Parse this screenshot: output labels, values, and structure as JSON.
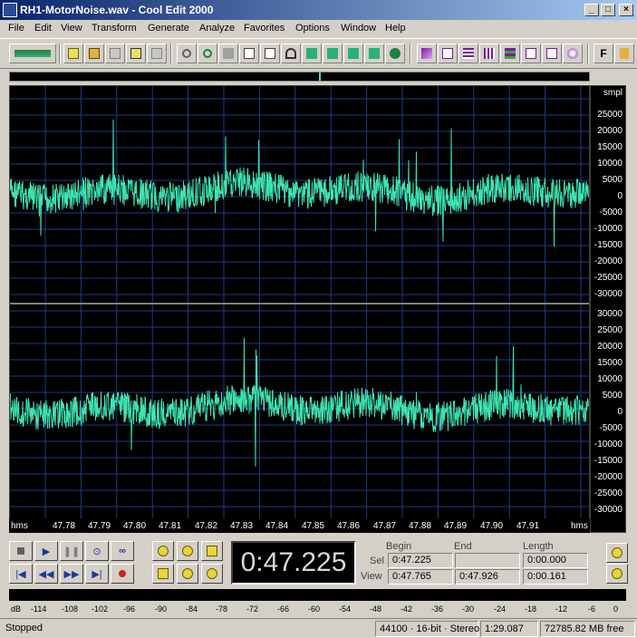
{
  "window": {
    "title": "RH1-MotorNoise.wav - Cool Edit 2000",
    "buttons": [
      "_",
      "□",
      "×"
    ]
  },
  "menu": [
    "File",
    "Edit",
    "View",
    "Transform",
    "Generate",
    "Analyze",
    "Favorites",
    "Options",
    "Window",
    "Help"
  ],
  "toolbar": {
    "icons": [
      "toggle-waveform-multitrack-icon",
      "new-file-icon",
      "open-file-icon",
      "close-file-icon",
      "save-file-icon",
      "save-all-icon",
      "undo-icon",
      "repeat-last-icon",
      "trim-icon",
      "copy-icon",
      "copy-new-icon",
      "cut-icon",
      "paste-icon",
      "paste-new-icon",
      "mix-paste-icon",
      "mix-paste-new-icon",
      "spectral-view-icon",
      "waveform-view-icon",
      "scroll-sync-icon",
      "snap-icon",
      "grid-icon",
      "loop-icon",
      "cue-list-icon",
      "cd-player-icon",
      "f-key-icon",
      "settings-icon"
    ]
  },
  "waveform": {
    "ruler_unit": "smpl",
    "ruler_labels_top": [
      "25000",
      "20000",
      "15000",
      "10000",
      "5000",
      "0",
      "-5000",
      "-10000",
      "-15000",
      "-20000",
      "-25000",
      "-30000"
    ],
    "ruler_labels_bottom": [
      "30000",
      "25000",
      "20000",
      "15000",
      "10000",
      "5000",
      "0",
      "-5000",
      "-10000",
      "-15000",
      "-20000",
      "-25000",
      "-30000"
    ],
    "waveform_color": "#3fe3b0",
    "grid_color": "#1e3a8a",
    "timeline": {
      "unit_label_left": "hms",
      "unit_label_right": "hms",
      "ticks": [
        "47.78",
        "47.79",
        "47.80",
        "47.81",
        "47.82",
        "47.83",
        "47.84",
        "47.85",
        "47.86",
        "47.87",
        "47.88",
        "47.89",
        "47.90",
        "47.91"
      ]
    }
  },
  "transport": {
    "buttons": [
      "stop",
      "play",
      "pause",
      "play-to-end",
      "loop",
      "go-to-start",
      "rewind",
      "fast-forward",
      "go-to-end",
      "record"
    ]
  },
  "zoom": {
    "buttons": [
      "zoom-in-horizontal",
      "zoom-out-horizontal",
      "zoom-full",
      "zoom-to-selection",
      "zoom-to-left-edge",
      "zoom-to-right-edge"
    ],
    "vertical": [
      "zoom-out-vertical",
      "zoom-in-vertical"
    ]
  },
  "time_display": "0:47.225",
  "selection": {
    "headers": {
      "begin": "Begin",
      "end": "End",
      "length": "Length"
    },
    "sel_label": "Sel",
    "view_label": "View",
    "sel_begin": "0:47.225",
    "sel_end": "",
    "sel_length": "0:00.000",
    "view_begin": "0:47.765",
    "view_end": "0:47.926",
    "view_length": "0:00.161"
  },
  "level_meter": {
    "labels": [
      "dB",
      "-114",
      "-108",
      "-102",
      "-96",
      "-90",
      "-84",
      "-78",
      "-72",
      "-66",
      "-60",
      "-54",
      "-48",
      "-42",
      "-36",
      "-30",
      "-24",
      "-18",
      "-12",
      "-6",
      "0"
    ]
  },
  "status": {
    "state": "Stopped",
    "format": "44100 · 16-bit · Stereo",
    "duration": "1:29.087",
    "free_space": "72785.82 MB free"
  }
}
